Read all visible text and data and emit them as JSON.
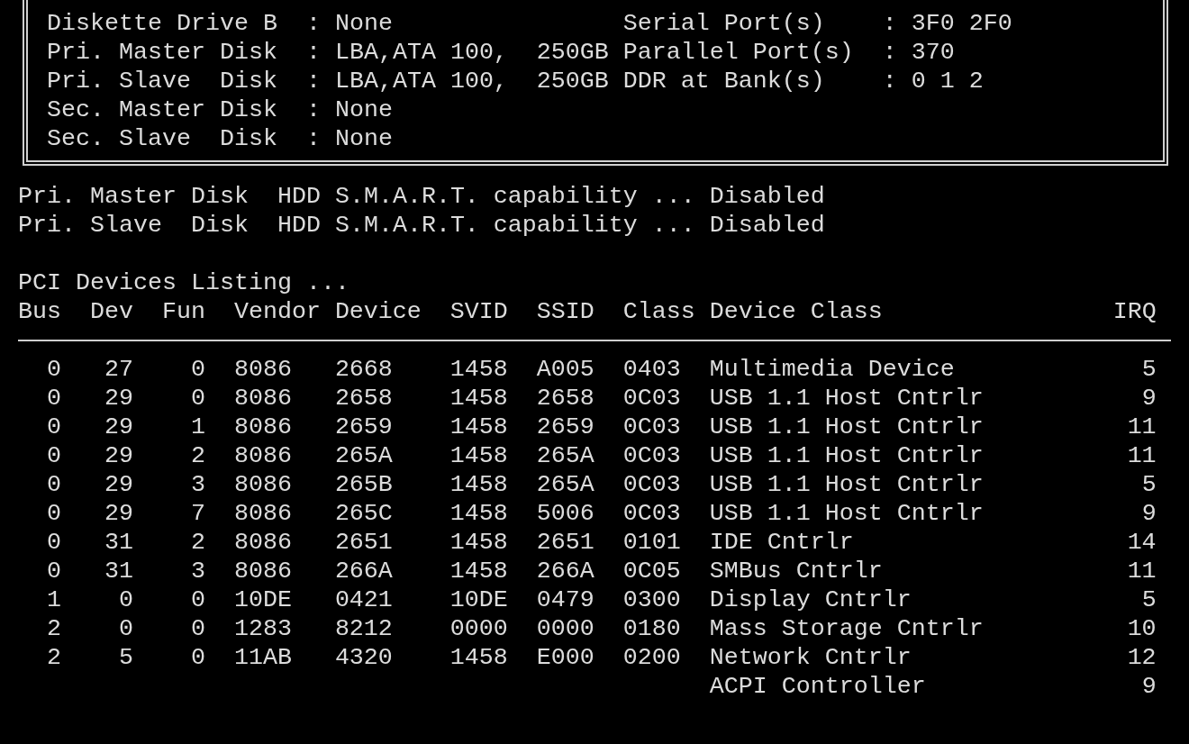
{
  "drives_box": {
    "rows": [
      {
        "label": "Diskette Drive B",
        "value": ": None",
        "right_label": "Serial Port(s)",
        "right_value": ": 3F0 2F0"
      },
      {
        "label": "Pri. Master Disk",
        "value": ": LBA,ATA 100,  250GB",
        "right_label": "Parallel Port(s)",
        "right_value": ": 370"
      },
      {
        "label": "Pri. Slave  Disk",
        "value": ": LBA,ATA 100,  250GB",
        "right_label": "DDR at Bank(s)",
        "right_value": ": 0 1 2"
      },
      {
        "label": "Sec. Master Disk",
        "value": ": None"
      },
      {
        "label": "Sec. Slave  Disk",
        "value": ": None"
      }
    ]
  },
  "smart_status": [
    {
      "disk": "Pri. Master Disk",
      "text": "HDD S.M.A.R.T. capability ...",
      "status": "Disabled"
    },
    {
      "disk": "Pri. Slave  Disk",
      "text": "HDD S.M.A.R.T. capability ...",
      "status": "Disabled"
    }
  ],
  "pci_listing": {
    "title": "PCI Devices Listing ...",
    "columns": [
      "Bus",
      "Dev",
      "Fun",
      "Vendor",
      "Device",
      "SVID",
      "SSID",
      "Class",
      "Device Class",
      "IRQ"
    ],
    "rows": [
      [
        "0",
        "27",
        "0",
        "8086",
        "2668",
        "1458",
        "A005",
        "0403",
        "Multimedia Device",
        "5"
      ],
      [
        "0",
        "29",
        "0",
        "8086",
        "2658",
        "1458",
        "2658",
        "0C03",
        "USB 1.1 Host Cntrlr",
        "9"
      ],
      [
        "0",
        "29",
        "1",
        "8086",
        "2659",
        "1458",
        "2659",
        "0C03",
        "USB 1.1 Host Cntrlr",
        "11"
      ],
      [
        "0",
        "29",
        "2",
        "8086",
        "265A",
        "1458",
        "265A",
        "0C03",
        "USB 1.1 Host Cntrlr",
        "11"
      ],
      [
        "0",
        "29",
        "3",
        "8086",
        "265B",
        "1458",
        "265A",
        "0C03",
        "USB 1.1 Host Cntrlr",
        "5"
      ],
      [
        "0",
        "29",
        "7",
        "8086",
        "265C",
        "1458",
        "5006",
        "0C03",
        "USB 1.1 Host Cntrlr",
        "9"
      ],
      [
        "0",
        "31",
        "2",
        "8086",
        "2651",
        "1458",
        "2651",
        "0101",
        "IDE Cntrlr",
        "14"
      ],
      [
        "0",
        "31",
        "3",
        "8086",
        "266A",
        "1458",
        "266A",
        "0C05",
        "SMBus Cntrlr",
        "11"
      ],
      [
        "1",
        "0",
        "0",
        "10DE",
        "0421",
        "10DE",
        "0479",
        "0300",
        "Display Cntrlr",
        "5"
      ],
      [
        "2",
        "0",
        "0",
        "1283",
        "8212",
        "0000",
        "0000",
        "0180",
        "Mass Storage Cntrlr",
        "10"
      ],
      [
        "2",
        "5",
        "0",
        "11AB",
        "4320",
        "1458",
        "E000",
        "0200",
        "Network Cntrlr",
        "12"
      ],
      [
        null,
        null,
        null,
        null,
        null,
        null,
        null,
        null,
        "ACPI Controller",
        "9"
      ]
    ]
  }
}
